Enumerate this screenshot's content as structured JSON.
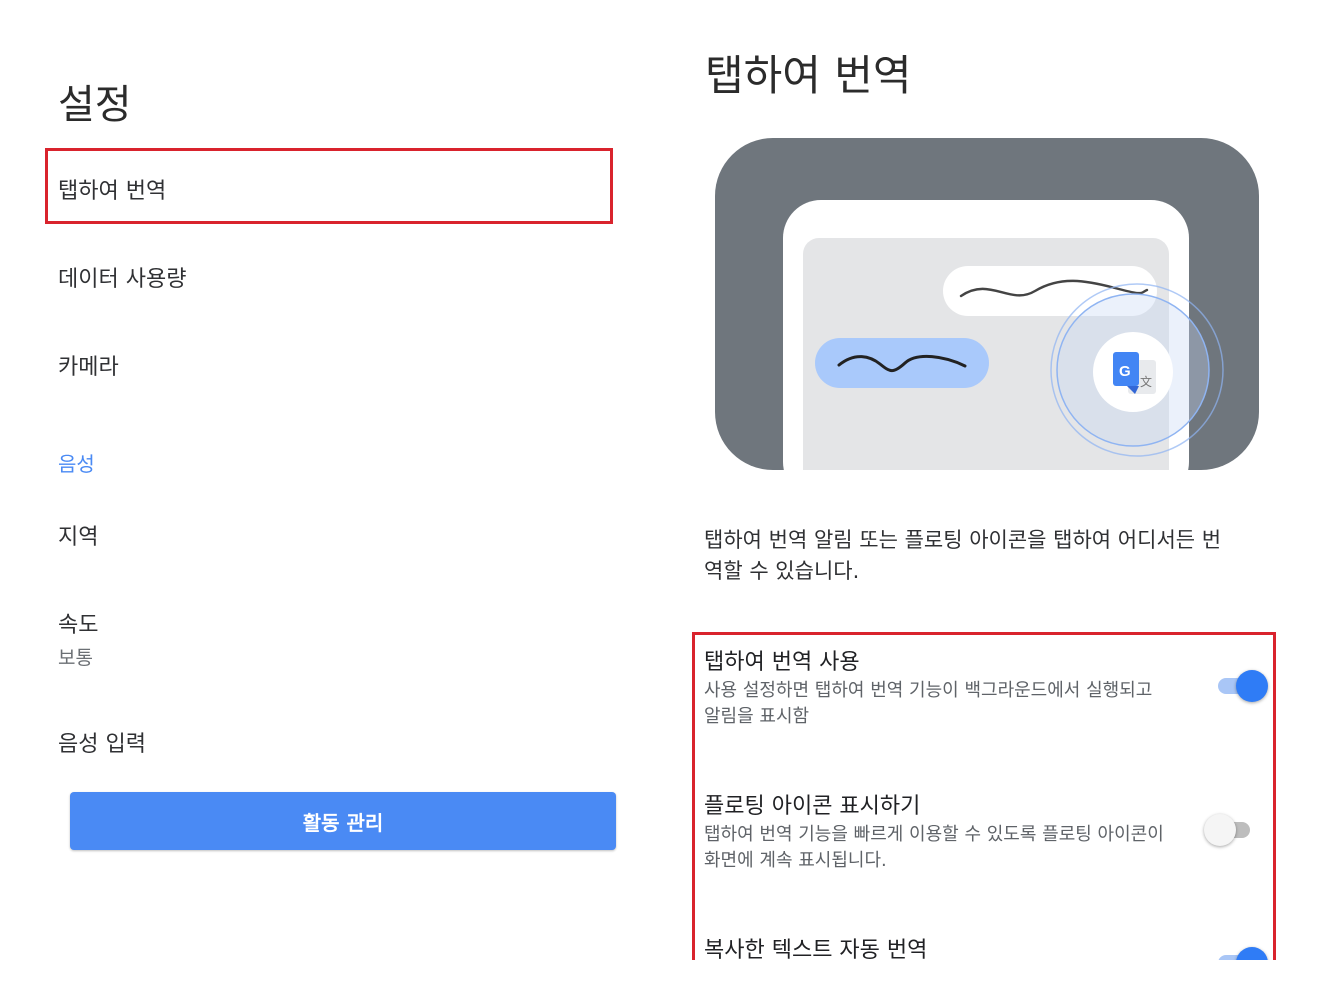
{
  "left": {
    "title": "설정",
    "items": [
      {
        "label": "탭하여 번역"
      },
      {
        "label": "데이터 사용량"
      },
      {
        "label": "카메라"
      }
    ],
    "section_voice": "음성",
    "region": "지역",
    "speed": {
      "label": "속도",
      "value": "보통"
    },
    "voice_input": "음성 입력",
    "activity_button": "활동 관리"
  },
  "right": {
    "title": "탭하여 번역",
    "description": "탭하여 번역 알림 또는 플로팅 아이콘을 탭하여 어디서든 번역할 수 있습니다.",
    "settings": [
      {
        "title": "탭하여 번역 사용",
        "subtitle": "사용 설정하면 탭하여 번역 기능이 백그라운드에서 실행되고 알림을 표시함",
        "enabled": true
      },
      {
        "title": "플로팅 아이콘 표시하기",
        "subtitle": "탭하여 번역 기능을 빠르게 이용할 수 있도록 플로팅 아이콘이 화면에 계속 표시됩니다.",
        "enabled": false
      },
      {
        "title": "복사한 텍스트 자동 번역",
        "enabled": true
      }
    ],
    "illustration_icon": "google-translate-icon"
  },
  "colors": {
    "accent": "#4a8af4",
    "highlight": "#d9232d",
    "toggle_on": "#2f7cf6"
  }
}
